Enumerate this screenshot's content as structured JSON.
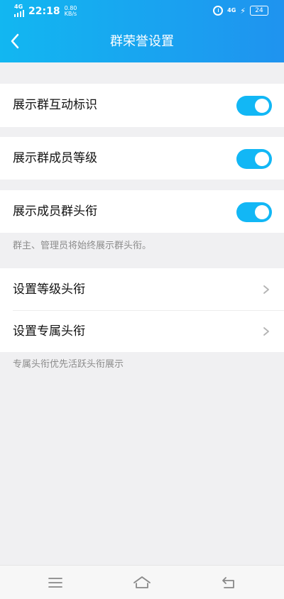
{
  "status_bar": {
    "network": "4G",
    "time": "22:18",
    "speed_value": "0.80",
    "speed_unit": "KB/s",
    "battery": "24"
  },
  "header": {
    "title": "群荣誉设置"
  },
  "settings": {
    "toggle_rows": [
      {
        "label": "展示群互动标识",
        "enabled": true
      },
      {
        "label": "展示群成员等级",
        "enabled": true
      },
      {
        "label": "展示成员群头衔",
        "enabled": true
      }
    ],
    "toggle_hint": "群主、管理员将始终展示群头衔。",
    "nav_rows": [
      {
        "label": "设置等级头衔"
      },
      {
        "label": "设置专属头衔"
      }
    ],
    "nav_hint": "专属头衔优先活跃头衔展示"
  },
  "colors": {
    "accent": "#12b7f5",
    "header_start": "#12b7f1",
    "header_end": "#1f93ef"
  },
  "icons": {
    "back": "chevron-left-icon",
    "row_arrow": "chevron-right-icon",
    "nav_menu": "menu-icon",
    "nav_home": "home-icon",
    "nav_back": "return-icon"
  }
}
